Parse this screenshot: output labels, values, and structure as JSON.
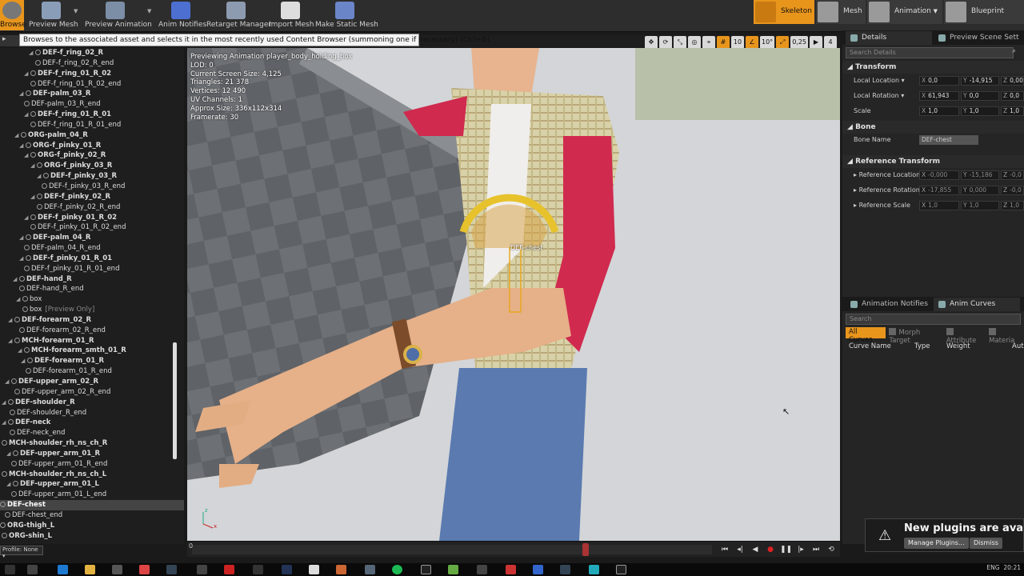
{
  "toolbar": {
    "buttons": [
      "Browse",
      "Preview Mesh",
      "Preview Animation",
      "Anim Notifies",
      "Retarget Manager",
      "Import Mesh",
      "Make Static Mesh"
    ],
    "modes": [
      "Skeleton",
      "Mesh",
      "Animation",
      "Blueprint"
    ]
  },
  "tooltip": "Browses to the associated asset and selects it in the most recently used Content Browser (summoning one if necessary) (Ctrl+B)",
  "tree": {
    "rows": [
      {
        "label": "DEF-f_ring_02_R",
        "bold": true,
        "arrow": true
      },
      {
        "label": "DEF-f_ring_02_R_end"
      },
      {
        "label": "DEF-f_ring_01_R_02",
        "bold": true,
        "arrow": true
      },
      {
        "label": "DEF-f_ring_01_R_02_end"
      },
      {
        "label": "DEF-palm_03_R",
        "bold": true,
        "arrow": true
      },
      {
        "label": "DEF-palm_03_R_end"
      },
      {
        "label": "DEF-f_ring_01_R_01",
        "bold": true,
        "arrow": true
      },
      {
        "label": "DEF-f_ring_01_R_01_end"
      },
      {
        "label": "ORG-palm_04_R",
        "bold": true,
        "arrow": true
      },
      {
        "label": "ORG-f_pinky_01_R",
        "bold": true,
        "arrow": true
      },
      {
        "label": "ORG-f_pinky_02_R",
        "bold": true,
        "arrow": true
      },
      {
        "label": "ORG-f_pinky_03_R",
        "bold": true,
        "arrow": true
      },
      {
        "label": "DEF-f_pinky_03_R",
        "bold": true,
        "arrow": true
      },
      {
        "label": "DEF-f_pinky_03_R_end"
      },
      {
        "label": "DEF-f_pinky_02_R",
        "bold": true,
        "arrow": true
      },
      {
        "label": "DEF-f_pinky_02_R_end"
      },
      {
        "label": "DEF-f_pinky_01_R_02",
        "bold": true,
        "arrow": true
      },
      {
        "label": "DEF-f_pinky_01_R_02_end"
      },
      {
        "label": "DEF-palm_04_R",
        "bold": true,
        "arrow": true
      },
      {
        "label": "DEF-palm_04_R_end"
      },
      {
        "label": "DEF-f_pinky_01_R_01",
        "bold": true,
        "arrow": true
      },
      {
        "label": "DEF-f_pinky_01_R_01_end"
      },
      {
        "label": "DEF-hand_R",
        "bold": true,
        "arrow": true
      },
      {
        "label": "DEF-hand_R_end"
      },
      {
        "label": "box",
        "arrow": true
      },
      {
        "label": "box",
        "sub": "[Preview Only]"
      },
      {
        "label": "DEF-forearm_02_R",
        "bold": true,
        "arrow": true
      },
      {
        "label": "DEF-forearm_02_R_end"
      },
      {
        "label": "MCH-forearm_01_R",
        "bold": true,
        "arrow": true
      },
      {
        "label": "MCH-forearm_smth_01_R",
        "bold": true,
        "arrow": true
      },
      {
        "label": "DEF-forearm_01_R",
        "bold": true,
        "arrow": true
      },
      {
        "label": "DEF-forearm_01_R_end"
      },
      {
        "label": "DEF-upper_arm_02_R",
        "bold": true,
        "arrow": true
      },
      {
        "label": "DEF-upper_arm_02_R_end"
      },
      {
        "label": "DEF-shoulder_R",
        "bold": true,
        "arrow": true
      },
      {
        "label": "DEF-shoulder_R_end"
      },
      {
        "label": "DEF-neck",
        "bold": true,
        "arrow": true
      },
      {
        "label": "DEF-neck_end"
      },
      {
        "label": "MCH-shoulder_rh_ns_ch_R",
        "bold": true
      },
      {
        "label": "DEF-upper_arm_01_R",
        "bold": true,
        "arrow": true
      },
      {
        "label": "DEF-upper_arm_01_R_end"
      },
      {
        "label": "MCH-shoulder_rh_ns_ch_L",
        "bold": true
      },
      {
        "label": "DEF-upper_arm_01_L",
        "bold": true,
        "arrow": true
      },
      {
        "label": "DEF-upper_arm_01_L_end"
      },
      {
        "label": "DEF-chest",
        "bold": true,
        "selected": true
      },
      {
        "label": "DEF-chest_end"
      },
      {
        "label": "ORG-thigh_L",
        "bold": true
      },
      {
        "label": "ORG-shin_L",
        "bold": true
      }
    ],
    "profile": "Profile: None"
  },
  "viewport": {
    "stats": [
      "Previewing Animation player_body_holding_box",
      "LOD: 0",
      "Current Screen Size: 4,125",
      "Triangles: 21 378",
      "Vertices: 12 490",
      "UV Channels: 1",
      "Approx Size: 336x112x314",
      "Framerate: 30"
    ],
    "bone_label": "DEF-chest",
    "grid_snap": "10",
    "rot_snap": "10°",
    "scale_snap": "0,25",
    "cam_speed": "4"
  },
  "timeline": {
    "start": "0"
  },
  "details": {
    "tab_details": "Details",
    "tab_scene": "Preview Scene Sett",
    "search_placeholder": "Search Details",
    "transform_header": "Transform",
    "local_location_label": "Local Location",
    "local_rotation_label": "Local Rotation",
    "scale_label": "Scale",
    "loc": [
      "0,0",
      "-14,915",
      "0,00"
    ],
    "rot": [
      "61,943",
      "0,0",
      "0,0"
    ],
    "scale": [
      "1,0",
      "1,0",
      "1,0"
    ],
    "bone_header": "Bone",
    "bone_name_label": "Bone Name",
    "bone_name": "DEF-chest",
    "ref_header": "Reference Transform",
    "ref_loc_label": "Reference Location",
    "ref_rot_label": "Reference Rotation",
    "ref_scale_label": "Reference Scale",
    "ref_loc": [
      "-0,000",
      "-15,186",
      "-0,0"
    ],
    "ref_rot": [
      "-17,855",
      "0,000",
      "-0,0"
    ],
    "ref_scale": [
      "1,0",
      "1,0",
      "1,0"
    ]
  },
  "curves": {
    "tab_notifies": "Animation Notifies",
    "tab_curves": "Anim Curves",
    "search_placeholder": "Search",
    "filter_all": "All Curves",
    "filter_morph": "Morph Target",
    "filter_attr": "Attribute",
    "filter_mat": "Materia",
    "col_name": "Curve Name",
    "col_type": "Type",
    "col_weight": "Weight",
    "col_auto": "Aut"
  },
  "toast": {
    "message": "New plugins are availa",
    "manage": "Manage Plugins...",
    "dismiss": "Dismiss"
  },
  "taskbar": {
    "lang": "ENG",
    "time": "20:21"
  }
}
